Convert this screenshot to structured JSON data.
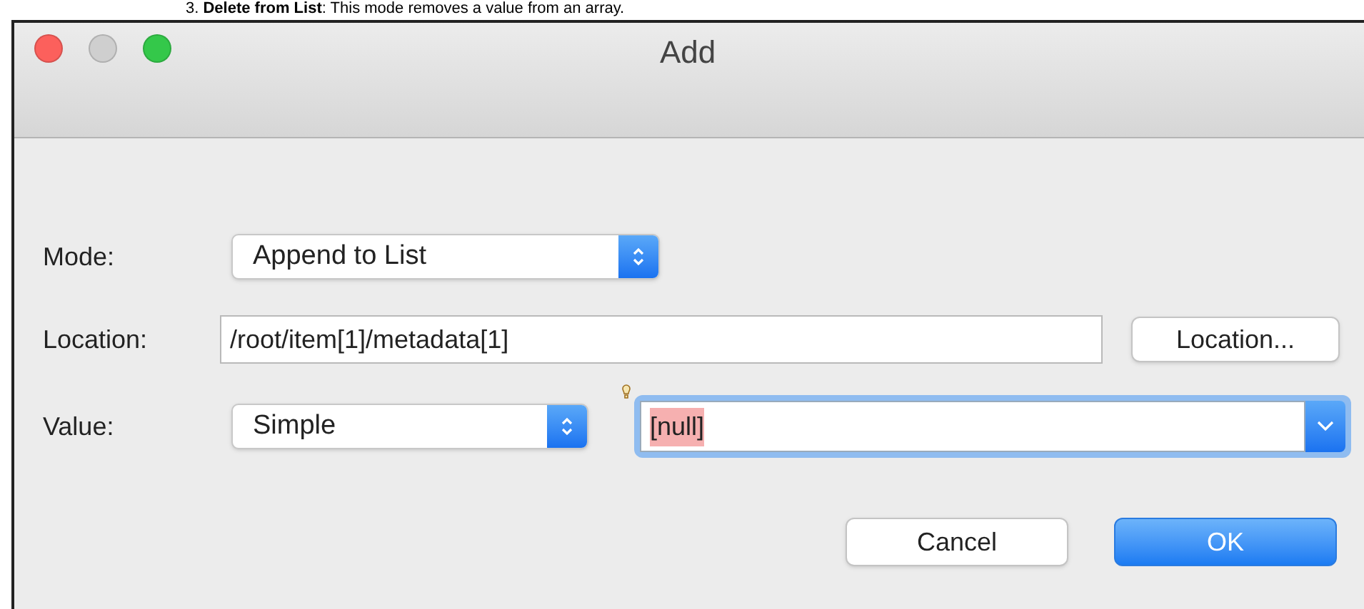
{
  "doc_text": "3. **Delete from List**: This mode removes a value from an array.",
  "window": {
    "title": "Add",
    "controls": [
      {
        "kind": "close",
        "enabled": true
      },
      {
        "kind": "minimize",
        "enabled": false
      },
      {
        "kind": "zoom",
        "enabled": true
      }
    ]
  },
  "form": {
    "mode": {
      "label": "Mode:",
      "value": "Append to List"
    },
    "location": {
      "label": "Location:",
      "value": "/root/item[1]/metadata[1]",
      "button": "Location..."
    },
    "value": {
      "label": "Value:",
      "type": "Simple",
      "combo_value": "[null]",
      "focused": true
    }
  },
  "buttons": [
    {
      "label": "Cancel",
      "default": false
    },
    {
      "label": "OK",
      "default": true
    }
  ]
}
